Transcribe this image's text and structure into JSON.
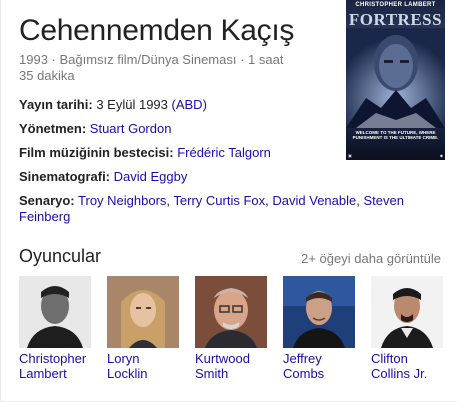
{
  "title": "Cehennemden Kaçış",
  "subtitle": "1993 · Bağımsız film/Dünya Sineması · 1 saat 35 dakika",
  "poster": {
    "actor": "CHRISTOPHER LAMBERT",
    "title": "FORTRESS",
    "tagline": "WELCOME TO THE FUTURE, WHERE PUNISHMENT IS THE ULTIMATE CRIME."
  },
  "facts": {
    "release_label": "Yayın tarihi:",
    "release_value": "3 Eylül 1993",
    "release_region": "(ABD)",
    "director_label": "Yönetmen:",
    "director_value": "Stuart Gordon",
    "composer_label": "Film müziğinin bestecisi:",
    "composer_value": "Frédéric Talgorn",
    "cinematography_label": "Sinematografi:",
    "cinematography_value": "David Eggby",
    "screenplay_label": "Senaryo:",
    "screenplay_values": [
      "Troy Neighbors",
      "Terry Curtis Fox",
      "David Venable",
      "Steven Feinberg"
    ]
  },
  "cast": {
    "header": "Oyuncular",
    "more": "2+ öğeyi daha görüntüle",
    "members": [
      {
        "line1": "Christopher",
        "line2": "Lambert"
      },
      {
        "line1": "Loryn",
        "line2": "Locklin"
      },
      {
        "line1": "Kurtwood",
        "line2": "Smith"
      },
      {
        "line1": "Jeffrey",
        "line2": "Combs"
      },
      {
        "line1": "Clifton",
        "line2": "Collins Jr."
      }
    ]
  },
  "colors": {
    "link": "#1a0dab",
    "muted": "#777777",
    "text": "#222222"
  }
}
